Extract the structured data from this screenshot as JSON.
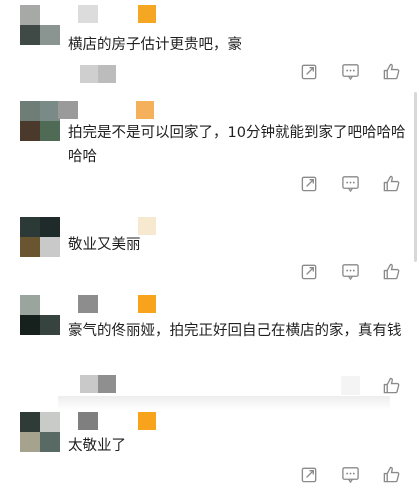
{
  "comments": [
    {
      "text": "横店的房子估计更贵吧，豪",
      "avatar_colors": [
        "#a7a9a6",
        "#ffffff",
        "#3f4a46",
        "#8a9490"
      ],
      "meta_colors": [
        "#dcdcdc",
        "#f5a623"
      ],
      "reply_colors": [
        "#cfcfcf",
        "#bcbcbc"
      ]
    },
    {
      "text": "拍完是不是可以回家了，10分钟就能到家了吧哈哈哈哈哈",
      "avatar_colors": [
        "#6f7d77",
        "#7a8a86",
        "#4b3a2c",
        "#4f6a55"
      ],
      "meta_colors": [
        "#9a9a9a",
        "#f4b05a"
      ],
      "reply_colors": [
        "#d7d7d7",
        "#c7c7c7"
      ]
    },
    {
      "text": "敬业又美丽",
      "avatar_colors": [
        "#2b3a36",
        "#1f2b2a",
        "#6a5531",
        "#c9c9c9"
      ],
      "meta_colors": [
        "#ffffff",
        "#f7e9cf"
      ],
      "reply_colors": [
        "#f2f2f2",
        "#ffffff"
      ]
    },
    {
      "text": "豪气的佟丽娅，拍完正好回自己在横店的家，真有钱",
      "avatar_colors": [
        "#9aa59e",
        "#ffffff",
        "#16201d",
        "#36433f"
      ],
      "meta_colors": [
        "#8d8d8d",
        "#f7a31c"
      ],
      "reply_colors": [
        "#c9c9c9",
        "#8f8f8f"
      ]
    },
    {
      "text": "太敬业了",
      "avatar_colors": [
        "#2f3b36",
        "#c8cbc8",
        "#a5a28e",
        "#586a63"
      ],
      "meta_colors": [
        "#7f7f7f",
        "#f7a31c"
      ],
      "reply_colors": [
        "#ffffff",
        "#ffffff"
      ]
    }
  ],
  "actions": {
    "share_icon": "share-icon",
    "comment_icon": "comment-icon",
    "like_icon": "thumbs-up-icon"
  }
}
